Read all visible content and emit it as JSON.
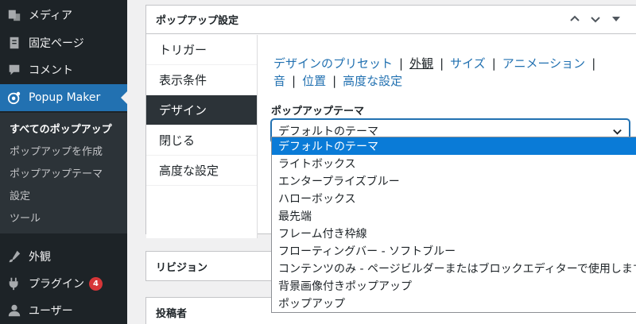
{
  "sidebar": {
    "menu": [
      {
        "label": "メディア",
        "icon": "media-icon"
      },
      {
        "label": "固定ページ",
        "icon": "pages-icon"
      },
      {
        "label": "コメント",
        "icon": "comments-icon"
      },
      {
        "label": "Popup Maker",
        "icon": "popup-maker-icon",
        "active": true
      },
      {
        "label": "外観",
        "icon": "appearance-icon"
      },
      {
        "label": "プラグイン",
        "icon": "plugins-icon",
        "badge": "4"
      },
      {
        "label": "ユーザー",
        "icon": "users-icon"
      }
    ],
    "submenu": [
      "すべてのポップアップ",
      "ポップアップを作成",
      "ポップアップテーマ",
      "設定",
      "ツール"
    ]
  },
  "settings_box": {
    "title": "ポップアップ設定",
    "tabs": [
      "トリガー",
      "表示条件",
      "デザイン",
      "閉じる",
      "高度な設定"
    ],
    "active_tab": "デザイン",
    "subtabs": [
      "デザインのプリセット",
      "外観",
      "サイズ",
      "アニメーション",
      "音",
      "位置",
      "高度な設定"
    ],
    "active_subtab": "外観",
    "theme_label": "ポップアップテーマ",
    "theme_value": "デフォルトのテーマ",
    "theme_options": [
      "デフォルトのテーマ",
      "ライトボックス",
      "エンタープライズブルー",
      "ハローボックス",
      "最先端",
      "フレーム付き枠線",
      "フローティングバー - ソフトブルー",
      "コンテンツのみ - ページビルダーまたはブロックエディターで使用します",
      "背景画像付きポップアップ",
      "ポップアップ"
    ]
  },
  "revision_box": {
    "title": "リビジョン"
  },
  "author_box": {
    "title": "投稿者"
  },
  "colors": {
    "admin_dark": "#1d2327",
    "accent": "#2271b1",
    "badge": "#d63638",
    "option_highlight": "#0a7bd7"
  }
}
